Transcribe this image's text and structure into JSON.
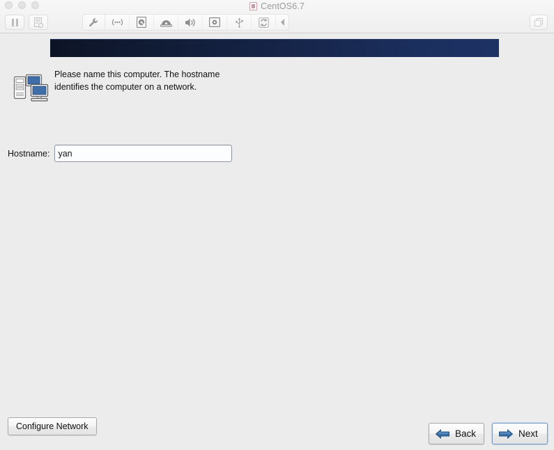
{
  "window": {
    "title": "CentOS6.7",
    "title_icon": "vm-disk-icon",
    "traffic_lights": [
      "close-button",
      "minimize-button",
      "zoom-button"
    ],
    "left_toolbar": [
      {
        "name": "pause-button",
        "icon": "pause-icon",
        "label": "Pause"
      },
      {
        "name": "snapshot-button",
        "icon": "snapshot-icon",
        "label": "Snapshot"
      }
    ],
    "center_toolbar": [
      {
        "name": "settings-button",
        "icon": "wrench-icon",
        "label": "Settings"
      },
      {
        "name": "network-button",
        "icon": "network-icon",
        "label": "Network Adapter"
      },
      {
        "name": "harddisk-button",
        "icon": "hard-disk-icon",
        "label": "Hard Disk"
      },
      {
        "name": "optical-drive-button",
        "icon": "cd-drive-icon",
        "label": "CD/DVD"
      },
      {
        "name": "sound-button",
        "icon": "speaker-icon",
        "label": "Sound Card"
      },
      {
        "name": "camera-button",
        "icon": "camera-icon",
        "label": "Camera"
      },
      {
        "name": "usb-button",
        "icon": "usb-icon",
        "label": "USB Devices"
      },
      {
        "name": "shared-folders-button",
        "icon": "sync-icon",
        "label": "Shared Folders"
      },
      {
        "name": "collapse-toolbar-button",
        "icon": "chevron-left-icon",
        "label": "Collapse"
      }
    ],
    "right_toolbar": [
      {
        "name": "fullscreen-button",
        "icon": "windows-overlap-icon",
        "label": "Full Screen"
      }
    ]
  },
  "installer": {
    "banner": {
      "name": "anaconda-banner",
      "gradient_from": "#0d1426",
      "gradient_to": "#1d3264"
    },
    "intro": {
      "icon": "computers-network-icon",
      "text": "Please name this computer.  The hostname identifies the computer on a network."
    },
    "hostname": {
      "label": "Hostname:",
      "value": "yan",
      "placeholder": ""
    },
    "configure_network": {
      "label": "Configure Network"
    },
    "nav": {
      "back": {
        "label": "Back",
        "icon": "arrow-left-icon"
      },
      "next": {
        "label": "Next",
        "icon": "arrow-right-icon",
        "focused": true
      }
    }
  },
  "colors": {
    "window_chrome": "#f4f4f4",
    "guest_background": "#ececec",
    "banner_dark": "#0d1426",
    "banner_blue": "#1d3264",
    "accent_arrow": "#3a6ea5",
    "text": "#111111",
    "muted_text": "#9a9a9a"
  }
}
